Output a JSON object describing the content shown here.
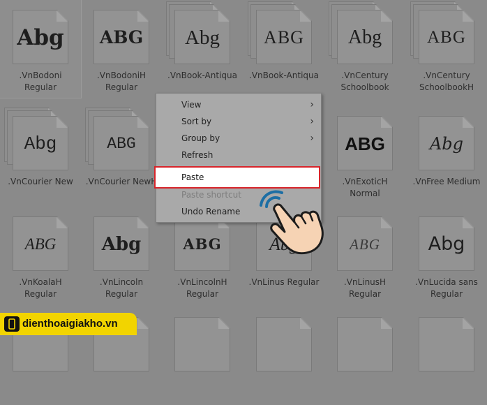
{
  "fonts": [
    {
      "sample": "Abg",
      "style": "f-bodoni",
      "name_line1": ".VnBodoni",
      "name_line2": "Regular",
      "stack": 0,
      "selected": true
    },
    {
      "sample": "ABG",
      "style": "f-bodonih",
      "name_line1": ".VnBodoniH",
      "name_line2": "Regular",
      "stack": 0
    },
    {
      "sample": "Abg",
      "style": "f-book",
      "name_line1": ".VnBook-Antiqua",
      "name_line2": "",
      "stack": 2
    },
    {
      "sample": "ABG",
      "style": "f-booku",
      "name_line1": ".VnBook-Antiqua",
      "name_line2": "",
      "stack": 2
    },
    {
      "sample": "Abg",
      "style": "f-century",
      "name_line1": ".VnCentury",
      "name_line2": "Schoolbook",
      "stack": 2
    },
    {
      "sample": "ABG",
      "style": "f-centuryh",
      "name_line1": ".VnCentury",
      "name_line2": "SchoolbookH",
      "stack": 2
    },
    {
      "sample": "Abg",
      "style": "f-courier",
      "name_line1": ".VnCourier New",
      "name_line2": "",
      "stack": 2
    },
    {
      "sample": "ABG",
      "style": "f-courierh",
      "name_line1": ".VnCourier NewH",
      "name_line2": "",
      "stack": 2
    },
    {
      "sample": "",
      "style": "",
      "name_line1": "",
      "name_line2": "",
      "stack": 0,
      "hidden": true
    },
    {
      "sample": "",
      "style": "",
      "name_line1": "",
      "name_line2": "",
      "stack": 0,
      "hidden": true
    },
    {
      "sample": "ABG",
      "style": "f-exotic",
      "name_line1": ".VnExoticH",
      "name_line2": "Normal",
      "stack": 0
    },
    {
      "sample": "Abg",
      "style": "f-free",
      "name_line1": ".VnFree Medium",
      "name_line2": "",
      "stack": 0
    },
    {
      "sample": "ABG",
      "style": "f-koala",
      "name_line1": ".VnKoalaH",
      "name_line2": "Regular",
      "stack": 0
    },
    {
      "sample": "Abg",
      "style": "f-lincoln",
      "name_line1": ".VnLincoln",
      "name_line2": "Regular",
      "stack": 0
    },
    {
      "sample": "ABG",
      "style": "f-lincolnh",
      "name_line1": ".VnLincolnH",
      "name_line2": "Regular",
      "stack": 0
    },
    {
      "sample": "Abg",
      "style": "f-linus",
      "name_line1": ".VnLinus Regular",
      "name_line2": "",
      "stack": 0
    },
    {
      "sample": "ABG",
      "style": "f-linush",
      "name_line1": ".VnLinusH",
      "name_line2": "Regular",
      "stack": 0
    },
    {
      "sample": "Abg",
      "style": "f-lucida",
      "name_line1": ".VnLucida sans",
      "name_line2": "Regular",
      "stack": 0
    },
    {
      "sample": "",
      "style": "",
      "name_line1": "",
      "name_line2": "",
      "stack": 0
    },
    {
      "sample": "",
      "style": "",
      "name_line1": "",
      "name_line2": "",
      "stack": 0
    },
    {
      "sample": "",
      "style": "",
      "name_line1": "",
      "name_line2": "",
      "stack": 0
    },
    {
      "sample": "",
      "style": "",
      "name_line1": "",
      "name_line2": "",
      "stack": 0
    },
    {
      "sample": "",
      "style": "",
      "name_line1": "",
      "name_line2": "",
      "stack": 0
    },
    {
      "sample": "",
      "style": "",
      "name_line1": "",
      "name_line2": "",
      "stack": 0
    }
  ],
  "context_menu": {
    "view": "View",
    "sort_by": "Sort by",
    "group_by": "Group by",
    "refresh": "Refresh",
    "paste": "Paste",
    "paste_shortcut": "Paste shortcut",
    "undo_rename": "Undo Rename",
    "submenu_arrow": "›",
    "highlight_color": "#d8242a"
  },
  "icons": {
    "pointer": "pointing-hand-icon",
    "brand": "phone-logo-icon"
  },
  "brand": {
    "text": "dienthoaigiakho.vn",
    "color": "#f2d400"
  }
}
